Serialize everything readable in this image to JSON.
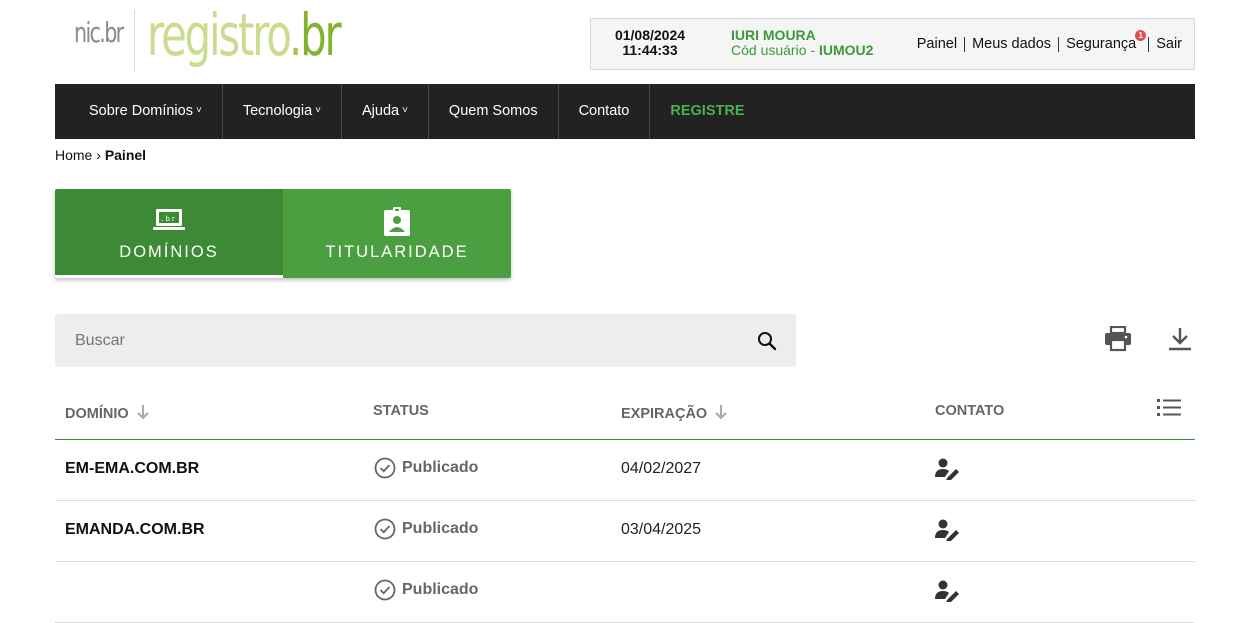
{
  "logo": {
    "nic": "nic",
    "nic_br": ".br",
    "registro": "registro",
    "dot": ".",
    "br": "br"
  },
  "userbox": {
    "date": "01/08/2024",
    "time": "11:44:33",
    "user_name": "IURI MOURA",
    "code_label": "Cód usuário - ",
    "code": "IUMOU2",
    "links": [
      "Painel",
      "Meus dados",
      "Segurança",
      "Sair"
    ],
    "security_badge": "1"
  },
  "nav": {
    "items": [
      "Sobre Domínios",
      "Tecnologia",
      "Ajuda",
      "Quem Somos",
      "Contato",
      "REGISTRE"
    ],
    "chevron": "˅"
  },
  "breadcrumb": {
    "home": "Home",
    "sep": "›",
    "current": "Painel"
  },
  "tabs": [
    {
      "label": "DOMÍNIOS",
      "icon": "laptop-br-icon"
    },
    {
      "label": "TITULARIDADE",
      "icon": "badge-icon"
    }
  ],
  "search": {
    "placeholder": "Buscar"
  },
  "table": {
    "headers": {
      "domain": "DOMÍNIO",
      "status": "STATUS",
      "expiration": "EXPIRAÇÃO",
      "contact": "CONTATO"
    },
    "rows": [
      {
        "domain": "EM-EMA.COM.BR",
        "status": "Publicado",
        "expiration": "04/02/2027"
      },
      {
        "domain": "EMANDA.COM.BR",
        "status": "Publicado",
        "expiration": "03/04/2025"
      },
      {
        "domain": "",
        "status": "Publicado",
        "expiration": ""
      }
    ]
  },
  "colors": {
    "green": "#3c8a36",
    "navbar": "#222222",
    "badge": "#e05050"
  }
}
